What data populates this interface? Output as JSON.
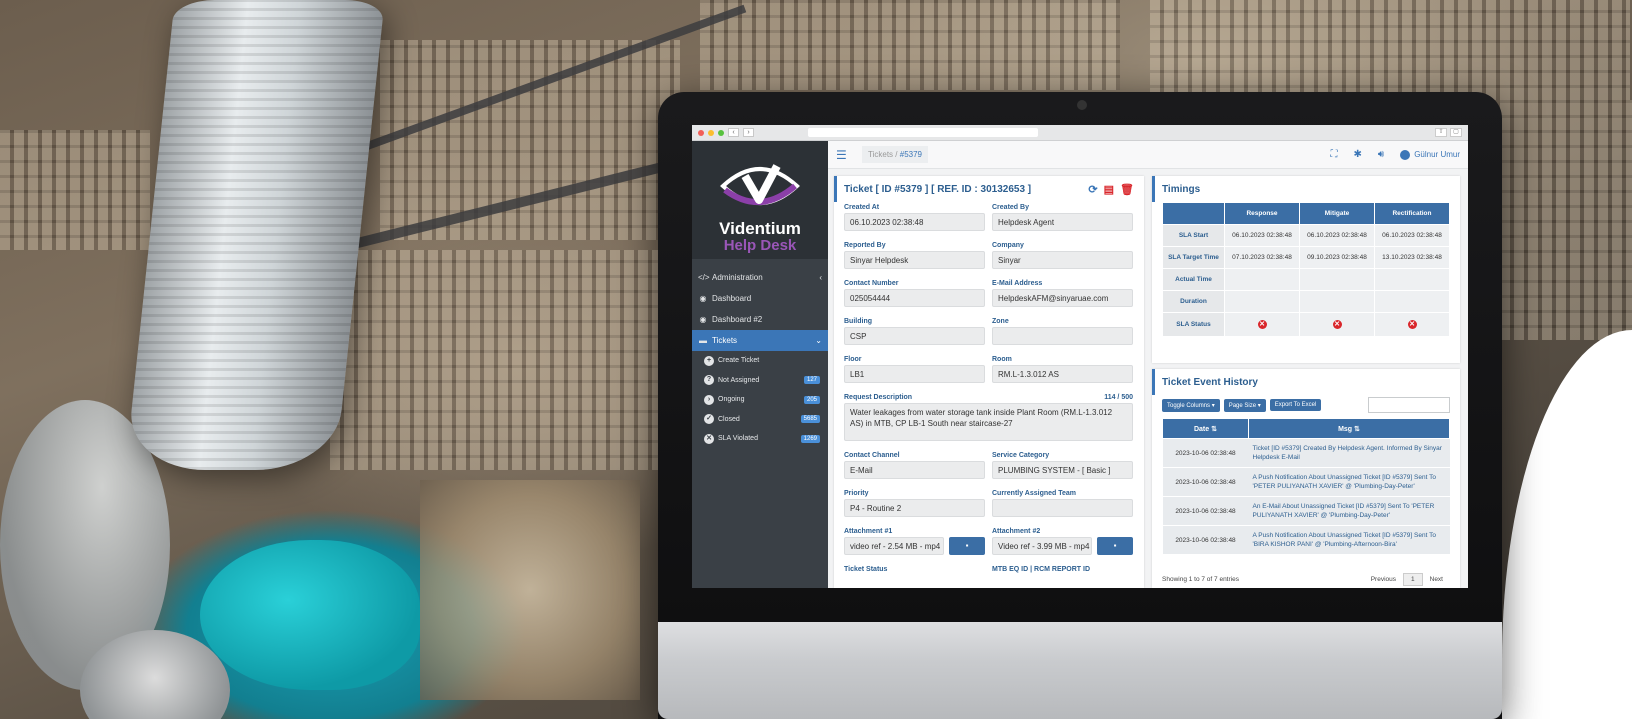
{
  "browser": {
    "back": "‹",
    "forward": "›"
  },
  "logo": {
    "line1": "Videntium",
    "line2": "Help Desk"
  },
  "sidebar": {
    "items": [
      {
        "label": "Administration",
        "icon": "code-icon"
      },
      {
        "label": "Dashboard",
        "icon": "dashboard-icon"
      },
      {
        "label": "Dashboard #2",
        "icon": "dashboard-icon"
      },
      {
        "label": "Tickets",
        "icon": "ticket-icon"
      }
    ],
    "subitems": [
      {
        "label": "Create Ticket",
        "badge": "",
        "icon": "plus-circle-icon"
      },
      {
        "label": "Not Assigned",
        "badge": "127",
        "icon": "question-circle-icon"
      },
      {
        "label": "Ongoing",
        "badge": "205",
        "icon": "play-circle-icon"
      },
      {
        "label": "Closed",
        "badge": "5685",
        "icon": "check-circle-icon"
      },
      {
        "label": "SLA Violated",
        "badge": "1269",
        "icon": "x-circle-icon"
      }
    ]
  },
  "topbar": {
    "breadcrumb_root": "Tickets",
    "breadcrumb_sep": "/",
    "breadcrumb_current": "#5379",
    "user_name": "Gülnur Umur"
  },
  "ticket": {
    "title": "Ticket [ ID #5379 ] [ REF. ID : 30132653 ]",
    "fields": {
      "created_at": {
        "label": "Created At",
        "value": "06.10.2023 02:38:48"
      },
      "created_by": {
        "label": "Created By",
        "value": "Helpdesk Agent"
      },
      "reported_by": {
        "label": "Reported By",
        "value": "Sinyar Helpdesk"
      },
      "company": {
        "label": "Company",
        "value": "Sinyar"
      },
      "contact_number": {
        "label": "Contact Number",
        "value": "025054444"
      },
      "email": {
        "label": "E-Mail Address",
        "value": "HelpdeskAFM@sinyaruae.com"
      },
      "building": {
        "label": "Building",
        "value": "CSP"
      },
      "zone": {
        "label": "Zone",
        "value": ""
      },
      "floor": {
        "label": "Floor",
        "value": "LB1"
      },
      "room": {
        "label": "Room",
        "value": "RM.L-1.3.012 AS"
      },
      "contact_channel": {
        "label": "Contact Channel",
        "value": "E-Mail"
      },
      "service_category": {
        "label": "Service Category",
        "value": "PLUMBING SYSTEM - [ Basic ]"
      },
      "priority": {
        "label": "Priority",
        "value": "P4 - Routine 2"
      },
      "assigned_team": {
        "label": "Currently Assigned Team",
        "value": ""
      },
      "attachment1": {
        "label": "Attachment #1",
        "value": "video ref - 2.54 MB - mp4"
      },
      "attachment2": {
        "label": "Attachment #2",
        "value": "Video ref - 3.99 MB - mp4"
      },
      "ticket_status": {
        "label": "Ticket Status"
      },
      "mtb": {
        "label": "MTB EQ ID | RCM REPORT ID"
      }
    },
    "request": {
      "label": "Request Description",
      "counter": "114 / 500",
      "value": "Water leakages from water storage tank inside Plant Room (RM.L-1.3.012 AS) in MTB, CP LB-1 South near staircase-27"
    }
  },
  "timings": {
    "title": "Timings",
    "columns": [
      "Response",
      "Mitigate",
      "Rectification"
    ],
    "rows": [
      {
        "label": "SLA Start",
        "values": [
          "06.10.2023 02:38:48",
          "06.10.2023 02:38:48",
          "06.10.2023 02:38:48"
        ]
      },
      {
        "label": "SLA Target Time",
        "values": [
          "07.10.2023 02:38:48",
          "09.10.2023 02:38:48",
          "13.10.2023 02:38:48"
        ]
      },
      {
        "label": "Actual Time",
        "values": [
          "",
          "",
          ""
        ]
      },
      {
        "label": "Duration",
        "values": [
          "",
          "",
          ""
        ]
      },
      {
        "label": "SLA Status",
        "values": [
          "✕",
          "✕",
          "✕"
        ]
      }
    ]
  },
  "history": {
    "title": "Ticket Event History",
    "toggle_columns": "Toggle Columns ▾",
    "page_size": "Page Size ▾",
    "export": "Export To Excel",
    "columns": [
      "Date",
      "Msg"
    ],
    "rows": [
      {
        "date": "2023-10-06 02:38:48",
        "msg": "Ticket [ID #5379] Created By Helpdesk Agent. Informed By Sinyar Helpdesk E-Mail"
      },
      {
        "date": "2023-10-06 02:38:48",
        "msg": "A Push Notification About Unassigned Ticket [ID #5379] Sent To 'PETER PULIYANATH XAVIER' @ 'Plumbing-Day-Peter'"
      },
      {
        "date": "2023-10-06 02:38:48",
        "msg": "An E-Mail About Unassigned Ticket [ID #5379] Sent To 'PETER PULIYANATH XAVIER' @ 'Plumbing-Day-Peter'"
      },
      {
        "date": "2023-10-06 02:38:48",
        "msg": "A Push Notification About Unassigned Ticket [ID #5379] Sent To 'BIRA KISHOR PANI' @ 'Plumbing-Afternoon-Bira'"
      }
    ],
    "showing": "Showing 1 to 7 of 7 entries",
    "previous": "Previous",
    "page": "1",
    "next": "Next"
  }
}
